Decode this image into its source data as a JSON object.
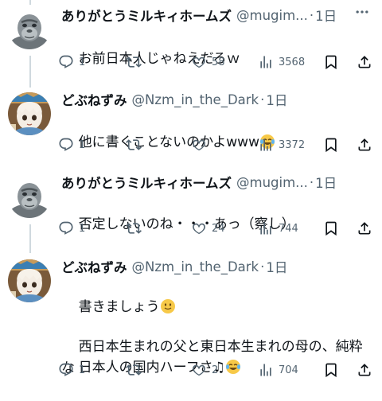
{
  "tweets": [
    {
      "name": "ありがとうミルキィホームズ",
      "handle": "@mugim...",
      "sep": "·",
      "time": "1日",
      "text": "お前日本人じゃねえだろｗ",
      "avatar_icon": "gorilla-avatar",
      "counts": {
        "reply": "1",
        "retweet": "",
        "like": "58",
        "views": "3568"
      }
    },
    {
      "name": "どぶねずみ",
      "handle": "@Nzm_in_the_Dark",
      "sep": "·",
      "time": "1日",
      "text": "他に書くことないのかよwww",
      "text_emoji": "face-with-tears-of-joy",
      "avatar_icon": "anime-girl-avatar",
      "counts": {
        "reply": "1",
        "retweet": "",
        "like": "",
        "views": "3372"
      }
    },
    {
      "name": "ありがとうミルキィホームズ",
      "handle": "@mugim...",
      "sep": "·",
      "time": "1日",
      "text": "否定しないのね・・・あっ（察し）",
      "avatar_icon": "gorilla-avatar",
      "counts": {
        "reply": "1",
        "retweet": "",
        "like": "24",
        "views": "744"
      }
    },
    {
      "name": "どぶねずみ",
      "handle": "@Nzm_in_the_Dark",
      "sep": "·",
      "time": "1日",
      "text": "書きましょう",
      "text_emoji": "slightly-smiling-face",
      "text2": "西日本生まれの父と東日本生まれの母の、純粋な",
      "text3": "日本人の国内ハーフさ♫",
      "text3_emoji": "face-with-tears-of-joy",
      "avatar_icon": "anime-girl-avatar",
      "counts": {
        "reply": "1",
        "retweet": "",
        "like": "2",
        "views": "704"
      }
    }
  ],
  "icons": {
    "more": "more-icon",
    "reply": "reply-icon",
    "retweet": "retweet-icon",
    "like": "like-icon",
    "views": "views-icon",
    "bookmark": "bookmark-icon",
    "share": "share-icon"
  },
  "colors": {
    "text": "#0f1419",
    "secondary": "#536471",
    "thread_line": "#cfd9de"
  }
}
